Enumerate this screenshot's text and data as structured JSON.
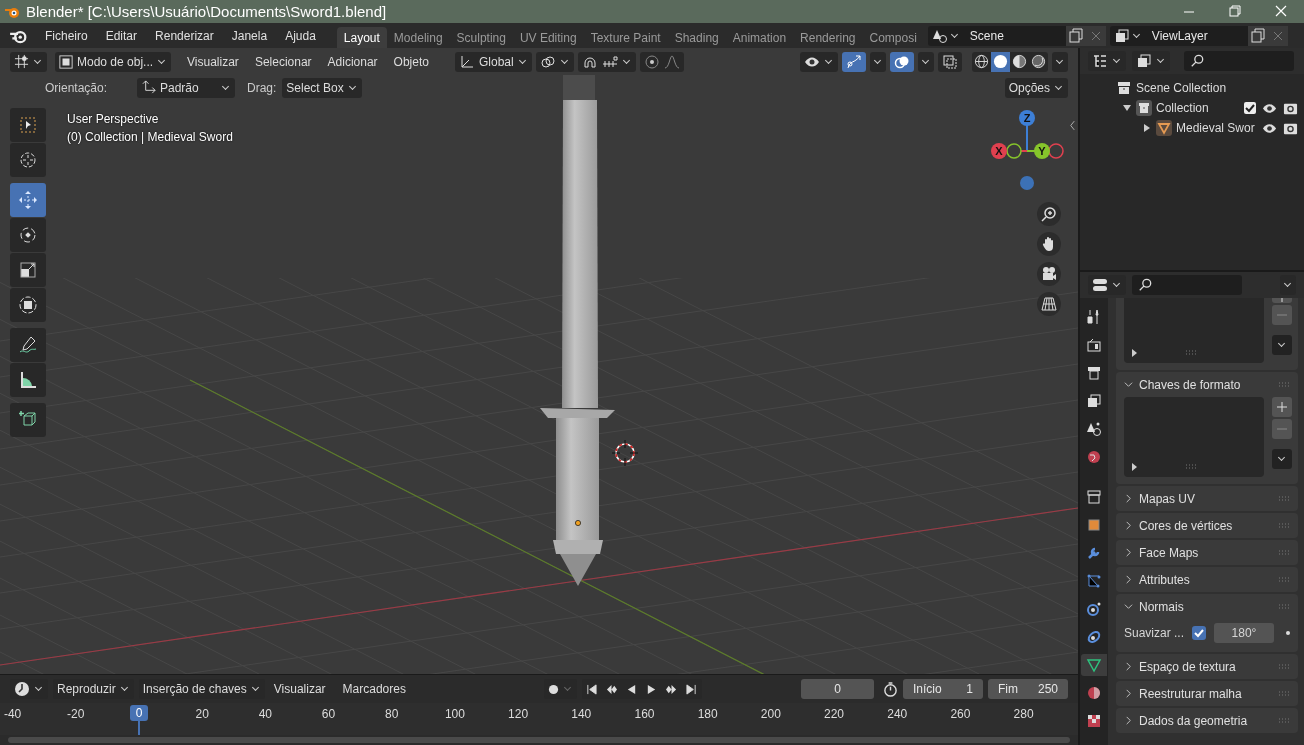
{
  "window": {
    "title": "Blender* [C:\\Users\\Usuário\\Documents\\Sword1.blend]"
  },
  "menu": [
    "Ficheiro",
    "Editar",
    "Renderizar",
    "Janela",
    "Ajuda"
  ],
  "workspaces": [
    {
      "label": "Layout",
      "selected": true
    },
    {
      "label": "Modeling",
      "selected": false
    },
    {
      "label": "Sculpting",
      "selected": false
    },
    {
      "label": "UV Editing",
      "selected": false
    },
    {
      "label": "Texture Paint",
      "selected": false
    },
    {
      "label": "Shading",
      "selected": false
    },
    {
      "label": "Animation",
      "selected": false
    },
    {
      "label": "Rendering",
      "selected": false
    },
    {
      "label": "Composi",
      "selected": false
    }
  ],
  "scene": {
    "name": "Scene"
  },
  "view_layer": {
    "name": "ViewLayer"
  },
  "viewport_header": {
    "mode": "Modo de obj...",
    "menus": [
      "Visualizar",
      "Selecionar",
      "Adicionar",
      "Objeto"
    ],
    "orientation": "Global",
    "shading": [
      {
        "kind": "wireframe",
        "selected": false
      },
      {
        "kind": "solid",
        "selected": true
      },
      {
        "kind": "material",
        "selected": false
      },
      {
        "kind": "rendered",
        "selected": false
      }
    ]
  },
  "tool_settings": {
    "orientation_label": "Orientação:",
    "orientation": "Padrão",
    "drag_label": "Drag:",
    "drag": "Select Box",
    "options": "Opções"
  },
  "viewport_info": [
    "User Perspective",
    "(0) Collection | Medieval Sword"
  ],
  "toolbar": {
    "groups": [
      {
        "tools": [
          {
            "kind": "select",
            "selected": false
          },
          {
            "kind": "cursor",
            "selected": false
          }
        ]
      },
      {
        "tools": [
          {
            "kind": "move",
            "selected": true
          },
          {
            "kind": "rotate",
            "selected": false
          },
          {
            "kind": "scale",
            "selected": false
          },
          {
            "kind": "transform",
            "selected": false
          }
        ]
      },
      {
        "tools": [
          {
            "kind": "annotate",
            "selected": false
          },
          {
            "kind": "measure",
            "selected": false
          }
        ]
      },
      {
        "tools": [
          {
            "kind": "add-cube",
            "selected": false
          }
        ]
      }
    ]
  },
  "gizmo_axes": [
    "X",
    "Y",
    "Z"
  ],
  "outliner": {
    "items": [
      {
        "label": "Scene Collection",
        "kind": "scene",
        "children": [
          {
            "label": "Collection",
            "kind": "collection",
            "expanded": true,
            "checked": true,
            "children": [
              {
                "label": "Medieval Swor",
                "kind": "mesh",
                "expanded": false
              }
            ]
          }
        ]
      }
    ]
  },
  "properties": {
    "tabs": [
      {
        "kind": "tool",
        "selected": false
      },
      {
        "kind": "render",
        "selected": false
      },
      {
        "kind": "output",
        "selected": false
      },
      {
        "kind": "view-layer",
        "selected": false
      },
      {
        "kind": "scene",
        "selected": false
      },
      {
        "kind": "world",
        "selected": false
      },
      {
        "kind": "collection",
        "selected": false
      },
      {
        "kind": "object",
        "selected": false
      },
      {
        "kind": "modifiers",
        "selected": false
      },
      {
        "kind": "particles",
        "selected": false
      },
      {
        "kind": "physics",
        "selected": false
      },
      {
        "kind": "constraints",
        "selected": false
      },
      {
        "kind": "data",
        "selected": true
      },
      {
        "kind": "material",
        "selected": false
      },
      {
        "kind": "texture",
        "selected": false
      }
    ],
    "panels": [
      {
        "kind": "list"
      },
      {
        "title": "Chaves de formato",
        "expanded": true,
        "kind": "list"
      },
      {
        "title": "Mapas UV",
        "expanded": false
      },
      {
        "title": "Cores de vértices",
        "expanded": false
      },
      {
        "title": "Face Maps",
        "expanded": false
      },
      {
        "title": "Attributes",
        "expanded": false
      },
      {
        "title": "Normais",
        "expanded": true,
        "kind": "setting",
        "setting": {
          "label": "Suavizar ...",
          "checked": true,
          "value": "180°"
        }
      },
      {
        "title": "Espaço de textura",
        "expanded": false
      },
      {
        "title": "Reestruturar malha",
        "expanded": false
      },
      {
        "title": "Dados da geometria",
        "expanded": false
      }
    ]
  },
  "timeline": {
    "menus": [
      "Reproduzir",
      "Inserção de chaves",
      "Visualizar",
      "Marcadores"
    ],
    "current_frame": "0",
    "start_label": "Início",
    "start": "1",
    "end_label": "Fim",
    "end": "250",
    "ruler": [
      {
        "label": "-40",
        "selected": false
      },
      {
        "label": "-20",
        "selected": false
      },
      {
        "label": "0",
        "selected": true
      },
      {
        "label": "20",
        "selected": false
      },
      {
        "label": "40",
        "selected": false
      },
      {
        "label": "60",
        "selected": false
      },
      {
        "label": "80",
        "selected": false
      },
      {
        "label": "100",
        "selected": false
      },
      {
        "label": "120",
        "selected": false
      },
      {
        "label": "140",
        "selected": false
      },
      {
        "label": "160",
        "selected": false
      },
      {
        "label": "180",
        "selected": false
      },
      {
        "label": "200",
        "selected": false
      },
      {
        "label": "220",
        "selected": false
      },
      {
        "label": "240",
        "selected": false
      },
      {
        "label": "260",
        "selected": false
      },
      {
        "label": "280",
        "selected": false
      }
    ]
  }
}
